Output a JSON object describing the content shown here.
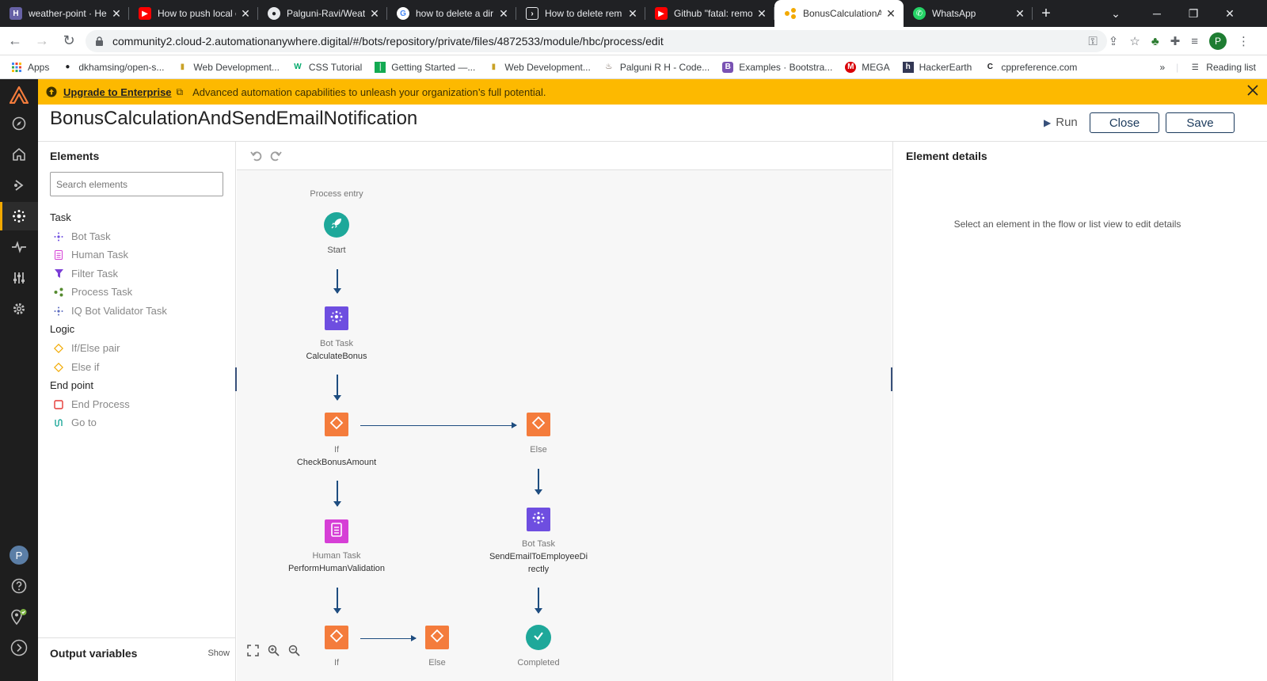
{
  "browser": {
    "tabs": [
      {
        "title": "weather-point · Her",
        "icon": "heroku-icon",
        "color": "#6762a6"
      },
      {
        "title": "How to push local c",
        "icon": "youtube-icon",
        "color": "#ff0000"
      },
      {
        "title": "Palguni-Ravi/Weath",
        "icon": "github-icon",
        "color": "#24292e"
      },
      {
        "title": "how to delete a dir",
        "icon": "google-icon",
        "color": "#4285f4"
      },
      {
        "title": "How to delete rem",
        "icon": "terminal-icon",
        "color": "#333333"
      },
      {
        "title": "Github \"fatal: remo",
        "icon": "youtube-icon",
        "color": "#ff0000"
      },
      {
        "title": "BonusCalculationA",
        "icon": "automation-anywhere-icon",
        "color": "#f2a900",
        "active": true
      },
      {
        "title": "WhatsApp",
        "icon": "whatsapp-icon",
        "color": "#25d366"
      }
    ],
    "url": "community2.cloud-2.automationanywhere.digital/#/bots/repository/private/files/4872533/module/hbc/process/edit",
    "profile_initial": "P",
    "bookmarks": [
      {
        "label": "Apps",
        "icon": "apps-grid-icon"
      },
      {
        "label": "dkhamsing/open-s...",
        "icon": "github-icon"
      },
      {
        "label": "Web Development...",
        "icon": "bookmark-icon"
      },
      {
        "label": "CSS Tutorial",
        "icon": "w3schools-icon"
      },
      {
        "label": "Getting Started —...",
        "icon": "mongodb-icon"
      },
      {
        "label": "Web Development...",
        "icon": "bookmark-icon"
      },
      {
        "label": "Palguni R H - Code...",
        "icon": "codechef-icon"
      },
      {
        "label": "Examples · Bootstra...",
        "icon": "bootstrap-icon"
      },
      {
        "label": "MEGA",
        "icon": "mega-icon"
      },
      {
        "label": "HackerEarth",
        "icon": "hackerearth-icon"
      },
      {
        "label": "cppreference.com",
        "icon": "cppreference-icon"
      }
    ],
    "reading_list": "Reading list",
    "more": "»"
  },
  "banner": {
    "link": "Upgrade to Enterprise",
    "text": "Advanced automation capabilities to unleash your organization’s full potential."
  },
  "header": {
    "title": "BonusCalculationAndSendEmailNotification",
    "run": "Run",
    "close": "Close",
    "save": "Save"
  },
  "elements_panel": {
    "title": "Elements",
    "search_placeholder": "Search elements",
    "categories": [
      {
        "label": "Task",
        "items": [
          "Bot Task",
          "Human Task",
          "Filter Task",
          "Process Task",
          "IQ Bot Validator Task"
        ]
      },
      {
        "label": "Logic",
        "items": [
          "If/Else pair",
          "Else if"
        ]
      },
      {
        "label": "End point",
        "items": [
          "End Process",
          "Go to"
        ]
      }
    ],
    "output_variables": "Output variables",
    "output_show": "Show"
  },
  "flow": {
    "entry": "Process entry",
    "start": "Start",
    "bot_task_1": {
      "type": "Bot Task",
      "name": "CalculateBonus"
    },
    "if_1": {
      "type": "If",
      "name": "CheckBonusAmount"
    },
    "else_1": "Else",
    "human_task": {
      "type": "Human Task",
      "name": "PerformHumanValidation"
    },
    "bot_task_2": {
      "type": "Bot Task",
      "name_line1": "SendEmailToEmployeeDi",
      "name_line2": "rectly"
    },
    "if_2": "If",
    "else_2": "Else",
    "completed": "Completed"
  },
  "details": {
    "title": "Element details",
    "hint": "Select an element in the flow or list view to edit details"
  },
  "colors": {
    "accent": "#fdb900",
    "navy": "#1b3a5c",
    "logic_orange": "#f47c3c",
    "bot_purple": "#6e4ee0",
    "human_pink": "#d63fd6",
    "teal": "#1ea89a"
  }
}
